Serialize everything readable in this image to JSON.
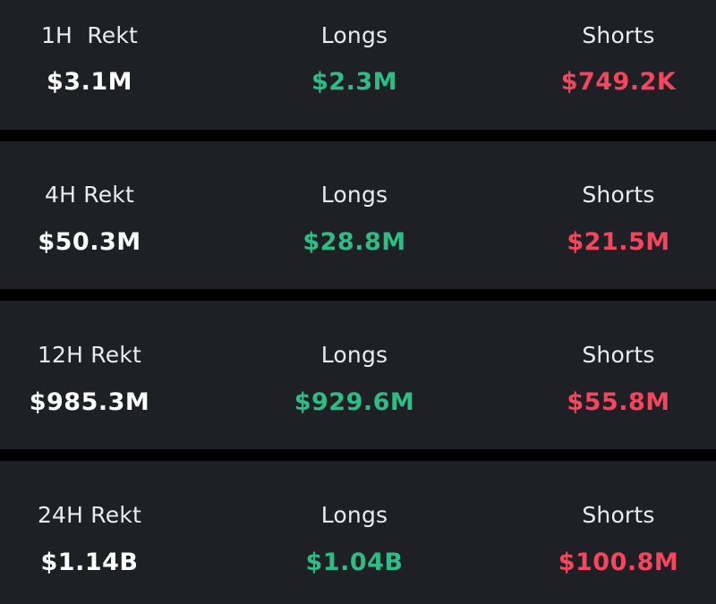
{
  "colors": {
    "background": "#000000",
    "panel": "#1e2025",
    "label": "#eaecef",
    "total": "#ffffff",
    "longs": "#2ebd85",
    "shorts": "#f6465d"
  },
  "rows": [
    {
      "period_label": "1H  Rekt",
      "total": "$3.1M",
      "longs_label": "Longs",
      "longs_value": "$2.3M",
      "shorts_label": "Shorts",
      "shorts_value": "$749.2K"
    },
    {
      "period_label": "4H Rekt",
      "total": "$50.3M",
      "longs_label": "Longs",
      "longs_value": "$28.8M",
      "shorts_label": "Shorts",
      "shorts_value": "$21.5M"
    },
    {
      "period_label": "12H Rekt",
      "total": "$985.3M",
      "longs_label": "Longs",
      "longs_value": "$929.6M",
      "shorts_label": "Shorts",
      "shorts_value": "$55.8M"
    },
    {
      "period_label": "24H Rekt",
      "total": "$1.14B",
      "longs_label": "Longs",
      "longs_value": "$1.04B",
      "shorts_label": "Shorts",
      "shorts_value": "$100.8M"
    }
  ]
}
